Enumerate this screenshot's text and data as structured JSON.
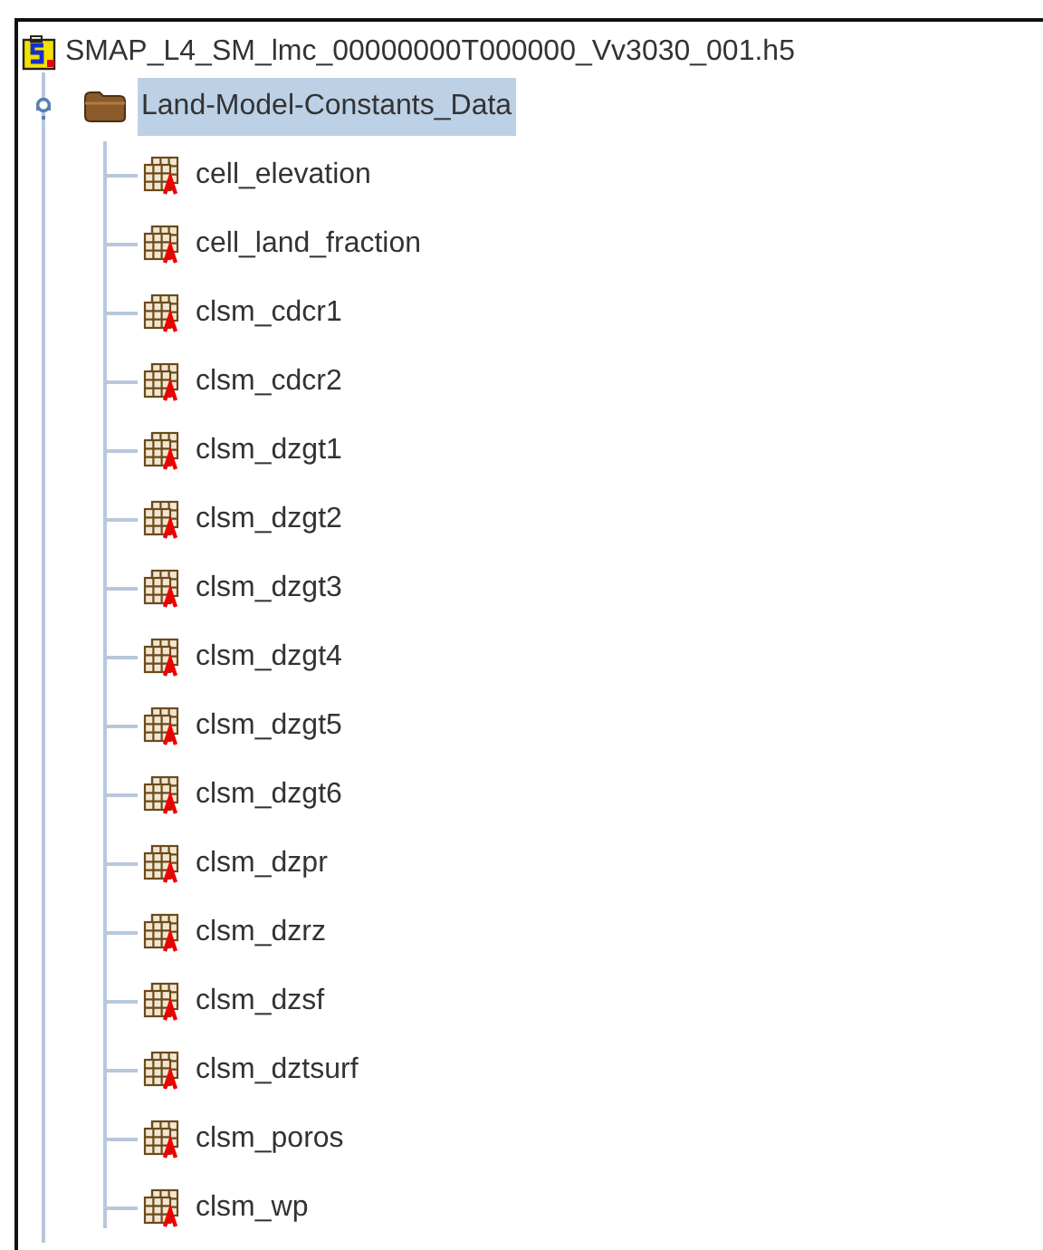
{
  "tree": {
    "label": "SMAP_L4_SM_lmc_00000000T000000_Vv3030_001.h5",
    "children": [
      {
        "label": "Land-Model-Constants_Data",
        "selected": true,
        "expanded": true,
        "children": [
          {
            "label": "cell_elevation"
          },
          {
            "label": "cell_land_fraction"
          },
          {
            "label": "clsm_cdcr1"
          },
          {
            "label": "clsm_cdcr2"
          },
          {
            "label": "clsm_dzgt1"
          },
          {
            "label": "clsm_dzgt2"
          },
          {
            "label": "clsm_dzgt3"
          },
          {
            "label": "clsm_dzgt4"
          },
          {
            "label": "clsm_dzgt5"
          },
          {
            "label": "clsm_dzgt6"
          },
          {
            "label": "clsm_dzpr"
          },
          {
            "label": "clsm_dzrz"
          },
          {
            "label": "clsm_dzsf"
          },
          {
            "label": "clsm_dztsurf"
          },
          {
            "label": "clsm_poros"
          },
          {
            "label": "clsm_wp"
          }
        ]
      }
    ]
  }
}
